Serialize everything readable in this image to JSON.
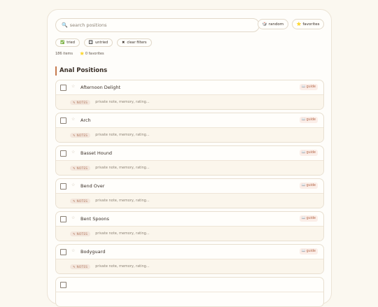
{
  "search": {
    "placeholder": "search positions",
    "icon": "search-icon"
  },
  "toolbar": {
    "random_label": "random",
    "random_icon": "🎲",
    "favorites_label": "favorites",
    "favorites_icon": "⭐"
  },
  "filters": [
    {
      "label": "tried",
      "icon": "✅"
    },
    {
      "label": "untried",
      "icon": "🔲"
    },
    {
      "label": "clear filters",
      "icon": "✖"
    }
  ],
  "stats": {
    "count": "186 items",
    "favorites": "0 favorites",
    "favorites_icon": "⭐"
  },
  "section": {
    "title": "Anal Positions"
  },
  "item_common": {
    "guide_label": "guide",
    "guide_icon": "📖",
    "notes_tag": "✎ NOTES",
    "note_placeholder": "private note, memory, rating...",
    "star": "☆"
  },
  "items": [
    {
      "name": "Afternoon Delight"
    },
    {
      "name": "Arch"
    },
    {
      "name": "Basset Hound"
    },
    {
      "name": "Bend Over"
    },
    {
      "name": "Bent Spoons"
    },
    {
      "name": "Bodyguard"
    },
    {
      "name": ""
    }
  ],
  "colors": {
    "accent": "#c67a4e",
    "background": "#fbf8f0",
    "card": "#fefdfa"
  }
}
